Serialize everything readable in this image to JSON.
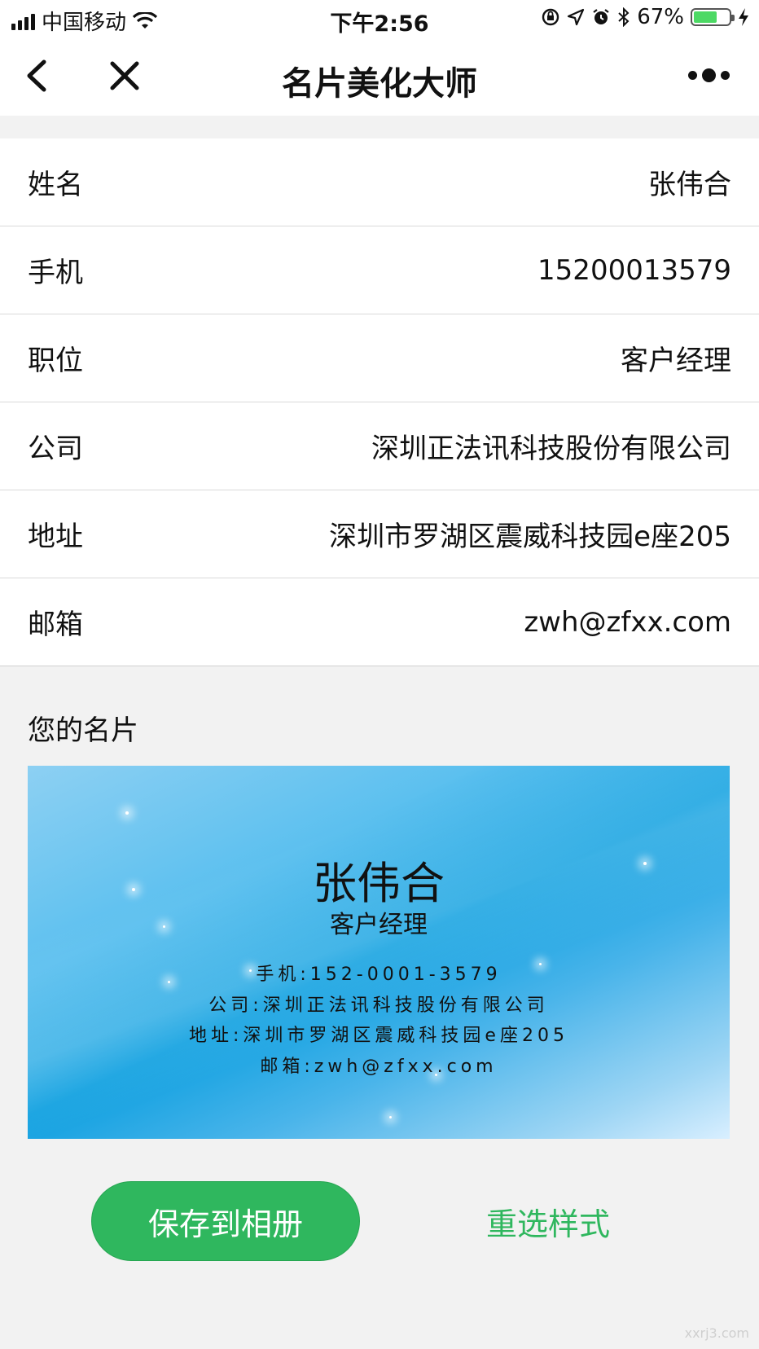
{
  "status_bar": {
    "carrier": "中国移动",
    "time": "下午2:56",
    "battery": "67%",
    "battery_level": 0.67
  },
  "nav": {
    "title": "名片美化大师"
  },
  "form": {
    "rows": [
      {
        "label": "姓名",
        "value": "张伟合"
      },
      {
        "label": "手机",
        "value": "15200013579"
      },
      {
        "label": "职位",
        "value": "客户经理"
      },
      {
        "label": "公司",
        "value": "深圳正法讯科技股份有限公司"
      },
      {
        "label": "地址",
        "value": "深圳市罗湖区震威科技园e座205"
      },
      {
        "label": "邮箱",
        "value": "zwh@zfxx.com"
      }
    ]
  },
  "card_section": {
    "title": "您的名片",
    "card": {
      "name": "张伟合",
      "position": "客户经理",
      "phone_line": "手机:152-0001-3579",
      "company_line": "公司:深圳正法讯科技股份有限公司",
      "address_line": "地址:深圳市罗湖区震威科技园e座205",
      "email_line": "邮箱:zwh@zfxx.com"
    }
  },
  "actions": {
    "save_label": "保存到相册",
    "restyle_label": "重选样式"
  },
  "watermark": "xxrj3.com",
  "colors": {
    "accent_green": "#2fb75e",
    "card_blue": "#0fa0e0"
  }
}
